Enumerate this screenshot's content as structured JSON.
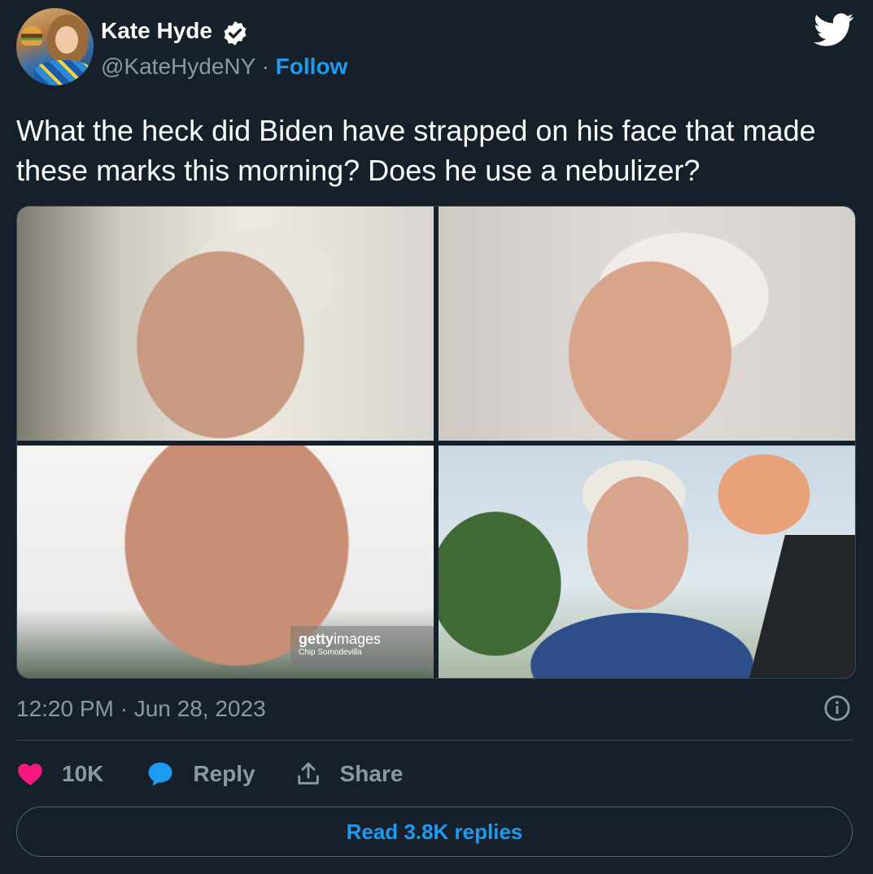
{
  "author": {
    "display_name": "Kate Hyde",
    "handle": "@KateHydeNY",
    "separator": "·",
    "follow_label": "Follow",
    "verified": true
  },
  "tweet": {
    "text": "What the heck did Biden have strapped on his face that made these marks this morning? Does he use a nebulizer?",
    "media_watermark": {
      "brand_bold": "getty",
      "brand_light": "images",
      "credit": "Chip Somodevilla"
    },
    "timestamp": "12:20 PM · Jun 28, 2023"
  },
  "actions": {
    "likes_count": "10K",
    "reply_label": "Reply",
    "share_label": "Share"
  },
  "read_replies_label": "Read 3.8K replies",
  "colors": {
    "background": "#15202b",
    "accent": "#1d9bf0",
    "like": "#f91880",
    "muted_text": "#8899a6",
    "divider": "#38444d"
  },
  "icons": [
    "verified-badge-icon",
    "twitter-bird-icon",
    "info-icon",
    "heart-icon",
    "reply-bubble-icon",
    "share-icon"
  ]
}
